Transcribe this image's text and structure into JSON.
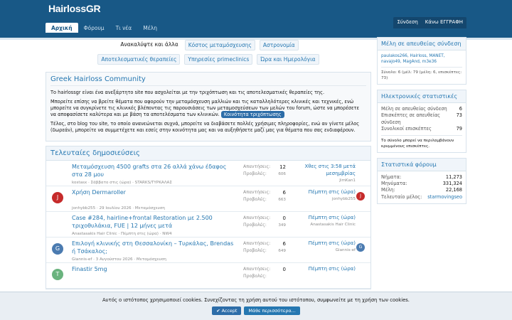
{
  "site": {
    "logo": "HairlossGR"
  },
  "header": {
    "login": "Σύνδεση",
    "register": "Κάνω ΕΓΓΡΑΦΗ"
  },
  "nav": {
    "tabs": [
      "Αρχική",
      "Φόρουμ",
      "Τι νέα",
      "Μέλη"
    ]
  },
  "tags": {
    "intro": "Ανακαλύψτε και άλλα",
    "row1": [
      "Κόστος μεταμόσχευσης",
      "Αστρονομία"
    ],
    "row2": [
      "Αποτελεσματικές θεραπείες",
      "Υπηρεσίες primeclinics",
      "Ώρα και Ημερολόγια"
    ]
  },
  "welcome": {
    "title": "Greek Hairloss Community",
    "p1": "Το hairlossgr είναι ένα ανεξάρτητο site που ασχολείται με την τριχόπτωση και τις αποτελεσματικές θεραπείες της.",
    "p2": "Μπορείτε επίσης να βρείτε θέματα που αφορούν την μεταμόσχευση μαλλιών και τις καταλληλότερες κλινικές και τεχνικές, ενώ μπορείτε να συγκρίνετε τις κλινικές βλέποντας τις παρουσιάσεις των μεταμοσχεύσεων των μελών του forum, ώστε να μπορέσετε να αποφασίσετε καλύτερα και με βάση τα αποτελέσματα των κλινικών.",
    "badge": "Κοινότητα τριχόπτωσης",
    "p3": "Τέλος, στο blog του site, το οποίο ανανεώνεται συχνά, μπορείτε να διαβάσετε πολλές χρήσιμες πληροφορίες, ενώ αν γίνετε μέλος (δωρεάν), μπορείτε να συμμετέχετε και εσείς στην κοινότητα μας και να αυξηθήσετε μαζί μας για θέματα που σας ενδιαφέρουν."
  },
  "latest": {
    "heading": "Τελευταίες δημοσιεύσεις",
    "label_replies": "Απαντήσεις:",
    "label_views": "Προβολές:",
    "rows": [
      {
        "title": "Μεταμόσχευση 4500 grafts στα 26 αλλά χάνω έδαφος στα 28 μου",
        "meta": "kostasx · Σάββατο στις (ώρα) · STARKS/ΤΥΡΚΑΛΑΣ",
        "replies": "12",
        "views": "606",
        "last": "Χθες στις 3:58 μετά μεσημβρίας",
        "user": "JimKan1",
        "avatar": "",
        "savatar": ""
      },
      {
        "title": "Χρήση Dermaroller",
        "meta": "jonhybb255 · 29 Ιουλίου 2026 · Μεταμόσχευση",
        "replies": "6",
        "views": "663",
        "last": "Πέμπτη στις (ώρα)",
        "user": "jonhybb255",
        "avatar": "J",
        "savatar": "J"
      },
      {
        "title": "Case #284, hairline+frontal Restoration με 2.500 τριχοθυλάκια, FUE | 12 μήνες μετά",
        "meta": "Anastasakis Hair Clinic · Πέμπτη στις (ώρα) · NW4",
        "replies": "0",
        "views": "349",
        "last": "Πέμπτη στις (ώρα)",
        "user": "Anastasakis Hair Clinic",
        "avatar": "",
        "savatar": ""
      },
      {
        "title": "Επιλογή κλινικής στη Θεσσαλονίκη – Τυρκάλας, Brendas ή Τσάκαλος;",
        "meta": "Giannis-ef · 3 Αυγούστου 2026 · Μεταμόσχευση",
        "replies": "6",
        "views": "649",
        "last": "Πέμπτη στις (ώρα)",
        "user": "Giannis-ef",
        "avatar": "G",
        "savatar": "G"
      },
      {
        "title": "Finastir 5mg",
        "meta": "",
        "replies": "0",
        "views": "",
        "last": "Πέμπτη στις (ώρα)",
        "user": "",
        "avatar": "Τ",
        "savatar": ""
      }
    ]
  },
  "sidebar": {
    "online_title": "Μέλη σε απευθείας σύνδεση",
    "online_users": "paulakos266, Hairloss, MANET, navajo49, MagAnd, m3e36",
    "online_total": "Σύνολο: 6 (μέλ: 79 (μέλη: 6, επισκέπτες: 73)",
    "ext_title": "Ηλεκτρονικές στατιστικές",
    "ext": [
      {
        "k": "Μέλη σε απευθείας σύνδεση",
        "v": "6"
      },
      {
        "k": "Επισκέπτες σε απευθείας σύνδεση",
        "v": "73"
      },
      {
        "k": "Συνολικοί επισκέπτες",
        "v": "79"
      }
    ],
    "ext_note": "Το σύνολο μπορεί να περιλαμβάνουν κρυμμένους επισκέπτες.",
    "forum_title": "Στατιστικά φόρουμ",
    "forum": [
      {
        "k": "Νήματα:",
        "v": "11,273"
      },
      {
        "k": "Μηνύματα:",
        "v": "331,324"
      },
      {
        "k": "Μέλη:",
        "v": "22,168"
      },
      {
        "k": "Τελευταίο μέλος:",
        "v": "starmovingseo"
      }
    ]
  },
  "cookie": {
    "msg": "Αυτός ο ιστότοπος χρησιμοποιεί cookies. Συνεχίζοντας τη χρήση αυτού του ιστότοπου, συμφωνείτε με τη χρήση των cookies.",
    "accept": "✔ Accept",
    "more": "Μάθε περισσότερα..."
  },
  "colors": {
    "brand": "#185886",
    "link": "#2577b1",
    "avatar_red": "#c62b2b",
    "avatar_blue": "#4b7bb0",
    "avatar_green": "#6ab37e"
  }
}
